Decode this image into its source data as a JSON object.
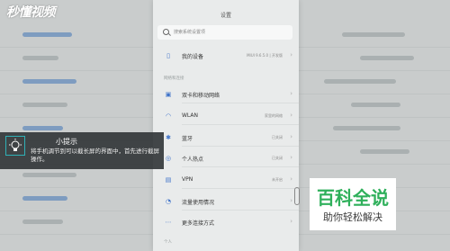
{
  "watermark": "秒懂视频",
  "settings": {
    "title": "设置",
    "search_placeholder": "搜索系统设置项",
    "my_device": {
      "label": "我的设备",
      "value": "MIUI 9.6.5.0 | 开发版"
    },
    "section_network": "网络和连接",
    "items": [
      {
        "label": "双卡和移动网络",
        "value": "",
        "icon": "sim-icon",
        "glyph": "▣"
      },
      {
        "label": "WLAN",
        "value": "家里的网络",
        "icon": "wifi-icon",
        "glyph": "◠"
      },
      {
        "label": "蓝牙",
        "value": "已关闭",
        "icon": "bluetooth-icon",
        "glyph": "✱"
      },
      {
        "label": "个人热点",
        "value": "已关闭",
        "icon": "hotspot-icon",
        "glyph": "◎"
      },
      {
        "label": "VPN",
        "value": "未开启",
        "icon": "vpn-icon",
        "glyph": "▤"
      },
      {
        "label": "流量使用情况",
        "value": "",
        "icon": "data-usage-icon",
        "glyph": "◔"
      },
      {
        "label": "更多连接方式",
        "value": "",
        "icon": "more-icon",
        "glyph": "⋯"
      }
    ],
    "section_personal": "个人"
  },
  "tip": {
    "title": "小提示",
    "body": "将手机调节到可以截长屏的界面中，首先进行截屏操作。"
  },
  "brand": {
    "title": "百科全说",
    "subtitle": "助你轻松解决"
  }
}
